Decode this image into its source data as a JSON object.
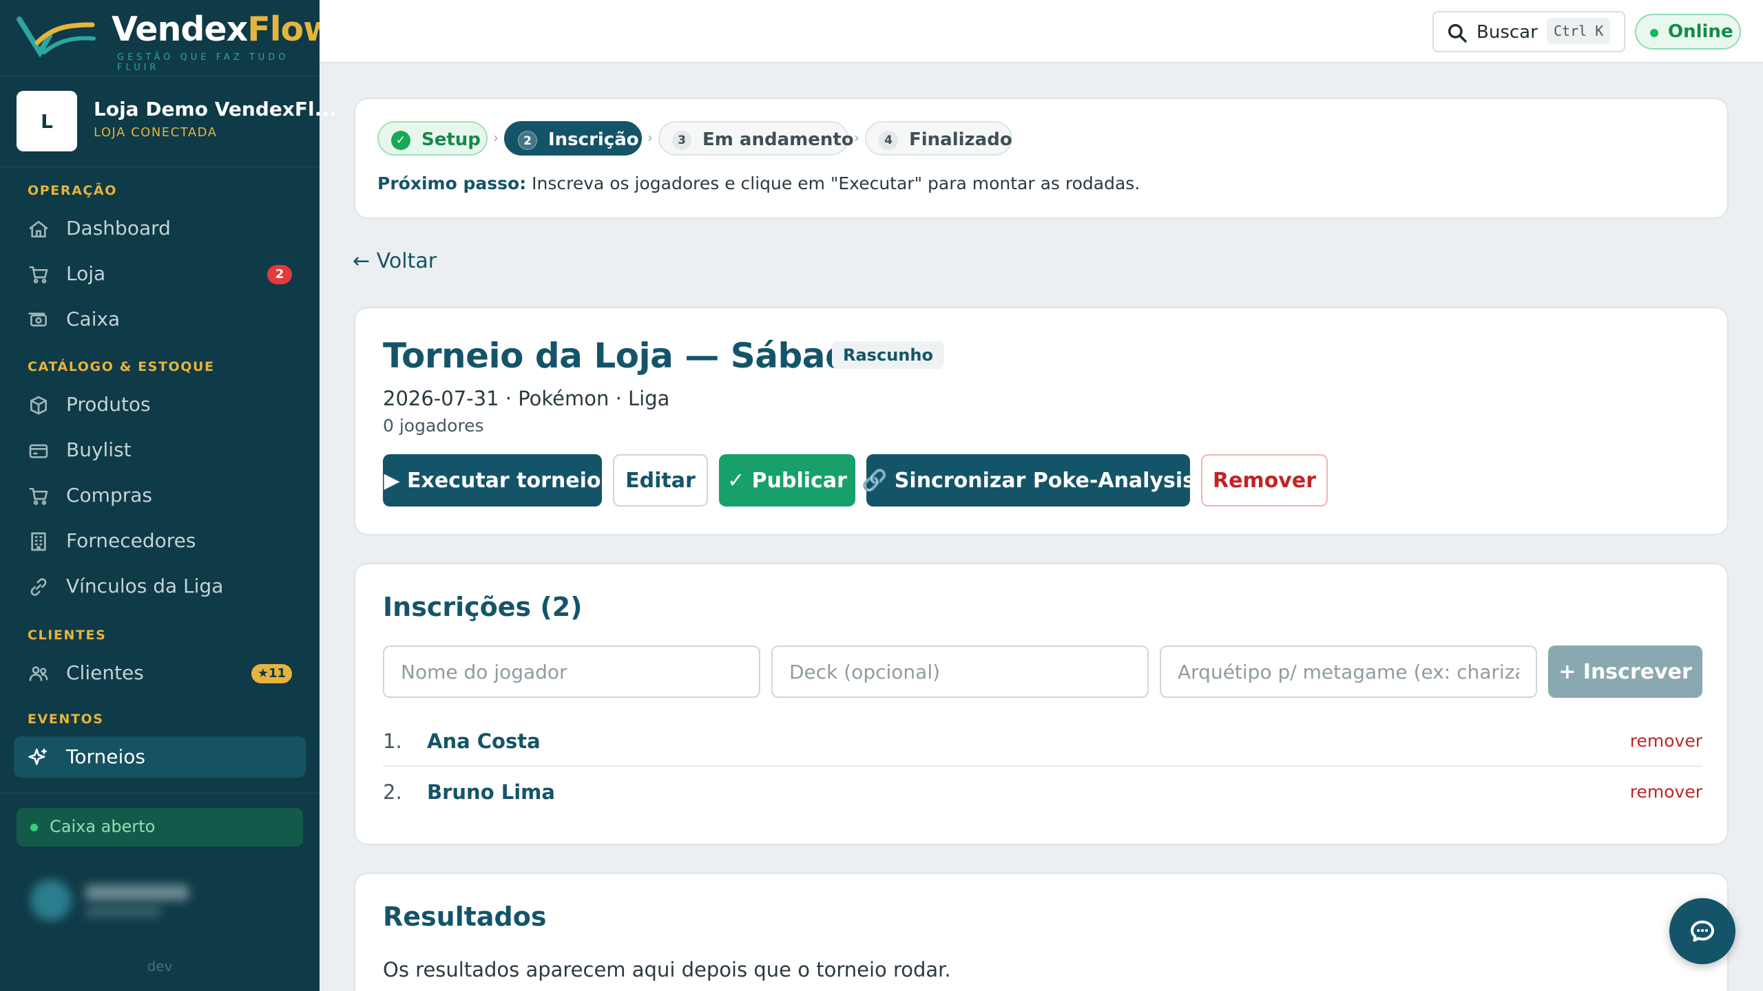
{
  "brand": {
    "name_part1": "Vendex",
    "name_part2": "Flow",
    "tagline": "GESTÃO QUE FAZ TUDO FLUIR"
  },
  "store": {
    "avatar": "L",
    "name": "Loja Demo VendexFl...",
    "status": "LOJA CONECTADA"
  },
  "nav": {
    "operacao": {
      "title": "OPERAÇÃO",
      "dashboard": "Dashboard",
      "loja": "Loja",
      "loja_badge": "2",
      "caixa": "Caixa"
    },
    "catalogo": {
      "title": "CATÁLOGO & ESTOQUE",
      "produtos": "Produtos",
      "buylist": "Buylist",
      "compras": "Compras",
      "fornecedores": "Fornecedores",
      "vinculos": "Vínculos da Liga"
    },
    "clientes": {
      "title": "CLIENTES",
      "clientes": "Clientes",
      "clientes_badge": "★11"
    },
    "eventos": {
      "title": "EVENTOS",
      "torneios": "Torneios"
    }
  },
  "sidebar_footer": {
    "caixa_status": "Caixa aberto",
    "env": "dev"
  },
  "topbar": {
    "search_label": "Buscar",
    "search_shortcut": "Ctrl K",
    "status": "Online"
  },
  "steps": {
    "items": [
      {
        "num": "✓",
        "label": "Setup",
        "state": "done"
      },
      {
        "num": "2",
        "label": "Inscrição",
        "state": "active"
      },
      {
        "num": "3",
        "label": "Em andamento",
        "state": "todo"
      },
      {
        "num": "4",
        "label": "Finalizado",
        "state": "todo"
      }
    ],
    "separator": "›",
    "next_step_label": "Próximo passo:",
    "next_step_text": " Inscreva os jogadores e clique em \"Executar\" para montar as rodadas."
  },
  "back_link": "← Voltar",
  "tournament": {
    "title": "Torneio da Loja — Sábado",
    "status": "Rascunho",
    "meta": "2026-07-31 · Pokémon · Liga",
    "players": "0 jogadores",
    "actions": {
      "execute": "▶ Executar torneio",
      "edit": "Editar",
      "publish": "✓ Publicar",
      "sync": "🔗 Sincronizar Poke-Analysis",
      "remove": "Remover"
    }
  },
  "registrations": {
    "title": "Inscrições (2)",
    "player_placeholder": "Nome do jogador",
    "deck_placeholder": "Deck (opcional)",
    "archetype_placeholder": "Arquétipo p/ metagame (ex: charizard)",
    "submit": "+ Inscrever",
    "remove_label": "remover",
    "players": [
      {
        "num": "1.",
        "name": "Ana Costa"
      },
      {
        "num": "2.",
        "name": "Bruno Lima"
      }
    ]
  },
  "results": {
    "title": "Resultados",
    "empty": "Os resultados aparecem aqui depois que o torneio rodar."
  },
  "colors": {
    "sidebar": "#0f3a47",
    "primary": "#145468",
    "accent": "#e6b43c",
    "success": "#18a06a",
    "danger": "#c22424"
  },
  "icons": [
    "home-icon",
    "cart-icon",
    "cash-register-icon",
    "box-icon",
    "card-icon",
    "building-icon",
    "link-icon",
    "users-icon",
    "sparkle-icon",
    "search-icon",
    "chat-icon"
  ]
}
